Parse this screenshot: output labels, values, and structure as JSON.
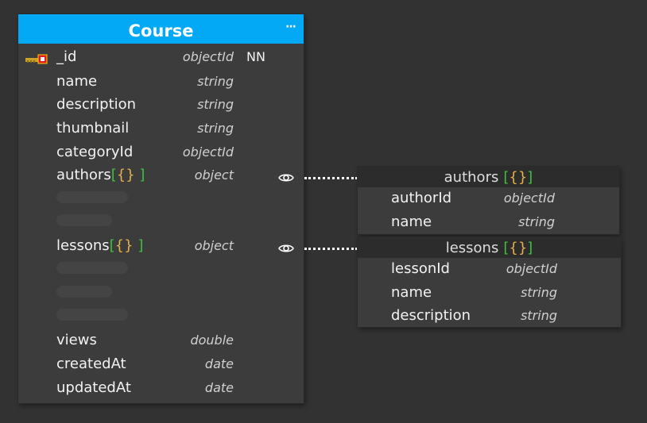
{
  "entity": {
    "title": "Course",
    "menu_icon": "more-icon",
    "fields": [
      {
        "name": "_id",
        "type": "objectId",
        "nn": "NN",
        "icon": "primary-key-icon"
      },
      {
        "name": "name",
        "type": "string"
      },
      {
        "name": "description",
        "type": "string"
      },
      {
        "name": "thumbnail",
        "type": "string"
      },
      {
        "name": "categoryId",
        "type": "objectId"
      },
      {
        "name": "authors",
        "type": "object",
        "brace_open": "{",
        "brace_close": "}",
        "bracket_open": "[",
        "bracket_close": "]",
        "icon": "eye-icon"
      },
      {
        "name": "lessons",
        "type": "object",
        "brace_open": "{",
        "brace_close": "}",
        "bracket_open": "[",
        "bracket_close": "]",
        "icon": "eye-icon"
      },
      {
        "name": "views",
        "type": "double"
      },
      {
        "name": "createdAt",
        "type": "date"
      },
      {
        "name": "updatedAt",
        "type": "date"
      }
    ]
  },
  "subdocs": {
    "authors": {
      "title": "authors",
      "bracket_open": "[",
      "brace_open": "{",
      "brace_close": "}",
      "bracket_close": "]",
      "fields": [
        {
          "name": "authorId",
          "type": "objectId"
        },
        {
          "name": "name",
          "type": "string"
        }
      ]
    },
    "lessons": {
      "title": "lessons",
      "bracket_open": "[",
      "brace_open": "{",
      "brace_close": "}",
      "bracket_close": "]",
      "fields": [
        {
          "name": "lessonId",
          "type": "objectId"
        },
        {
          "name": "name",
          "type": "string"
        },
        {
          "name": "description",
          "type": "string"
        }
      ]
    }
  },
  "colors": {
    "header_accent": "#03a9f4",
    "brace": "#e6b04a",
    "bracket": "#3fbf3f",
    "canvas": "#323232",
    "panel": "#3c3c3c"
  }
}
